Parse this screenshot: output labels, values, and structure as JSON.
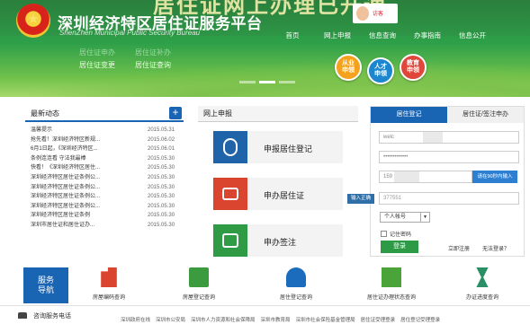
{
  "site": {
    "title": "深圳经济特区居住证服务平台",
    "subtitle": "ShenZhen Municipal Public Security Bureau",
    "slogan": "居住证网上办理已开通"
  },
  "nav": {
    "items": [
      "首页",
      "网上申报",
      "信息查询",
      "办事指南",
      "信息公开"
    ]
  },
  "banner": {
    "sub_links": [
      [
        "居住证申办",
        "居住证补办"
      ],
      [
        "居住证变更",
        "居住证查询"
      ]
    ],
    "bubbles": [
      [
        "从业",
        "申领"
      ],
      [
        "人才",
        "申领"
      ],
      [
        "教育",
        "申领"
      ]
    ],
    "visitor": "访客",
    "slides": 3,
    "active_slide": 1
  },
  "news": {
    "title": "最新动态",
    "items": [
      {
        "text": "温馨提示",
        "date": "2015.05.31"
      },
      {
        "text": "抢先看！深圳经济特区新规...",
        "date": "2015.06.02"
      },
      {
        "text": "6月1日起，《深圳经济特区...",
        "date": "2015.06.01"
      },
      {
        "text": "条例连连看 守法我最棒",
        "date": "2015.05.30"
      },
      {
        "text": "快看！《深圳经济特区居住...",
        "date": "2015.05.30"
      },
      {
        "text": "深圳经济特区居住证条例公...",
        "date": "2015.05.30"
      },
      {
        "text": "深圳经济特区居住证条例公...",
        "date": "2015.05.30"
      },
      {
        "text": "深圳经济特区居住证条例公...",
        "date": "2015.05.30"
      },
      {
        "text": "深圳经济特区居住证条例公...",
        "date": "2015.05.30"
      },
      {
        "text": "深圳经济特区居住证条例",
        "date": "2015.05.30"
      },
      {
        "text": "深圳市居住证和居住证办...",
        "date": "2015.05.30"
      }
    ]
  },
  "apply": {
    "title": "网上申报",
    "services": [
      {
        "label": "申报居住登记",
        "color": "blue",
        "icon": "mouse-icon"
      },
      {
        "label": "申办居住证",
        "color": "red",
        "icon": "id-card-icon"
      },
      {
        "label": "申办签注",
        "color": "green",
        "icon": "stamp-icon"
      }
    ]
  },
  "login": {
    "tab_active": "居住登记",
    "tab_inactive": "居住证/签注申办",
    "username": "welc",
    "password_mask": "•••••••••••••",
    "phone": "159",
    "code_button": "请在90秒内输入",
    "tip": "输入正确",
    "captcha_value": "377551",
    "account_type": "个人帐号",
    "remember": "记住密码",
    "submit": "登录",
    "register": "立即注册",
    "forgot": "无法登录？"
  },
  "services_bar": {
    "tile": [
      "服务",
      "导航"
    ],
    "items": [
      {
        "label": "房屋编码查询",
        "icon": "building-icon"
      },
      {
        "label": "房屋登记查询",
        "icon": "house-register-icon"
      },
      {
        "label": "居住登记查询",
        "icon": "people-icon"
      },
      {
        "label": "居住证办理状态查询",
        "icon": "id-status-icon"
      },
      {
        "label": "办证进度查询",
        "icon": "hourglass-icon"
      }
    ]
  },
  "footer": {
    "hotline": "咨询服务电话",
    "links": [
      "深圳政府在线",
      "深圳市公安局",
      "深圳市人力资源和社会保障局",
      "深圳市教育局",
      "深圳市社会保险基金管理局",
      "居住证受理登录",
      "居住登记受理登录"
    ]
  }
}
